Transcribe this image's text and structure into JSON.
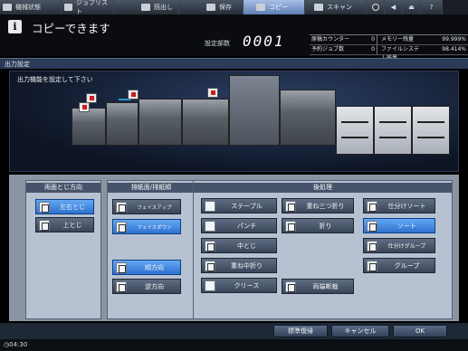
{
  "topbar": {
    "tabs": [
      {
        "label": "機械状態",
        "icon": "machine-status-icon",
        "active": false
      },
      {
        "label": "ジョブリスト",
        "icon": "job-list-icon",
        "active": false
      },
      {
        "label": "読出し",
        "icon": "recall-icon",
        "active": false
      },
      {
        "label": "保存",
        "icon": "save-icon",
        "active": false
      },
      {
        "label": "コピー",
        "icon": "copy-icon",
        "active": true
      },
      {
        "label": "スキャン",
        "icon": "scan-icon",
        "active": false
      }
    ],
    "icons": [
      "globe-icon",
      "volume-icon",
      "eject-icon",
      "help-icon"
    ],
    "help_label": "?"
  },
  "message": {
    "icon_label": "i",
    "text": "コピーできます",
    "set_count_label": "設定部数",
    "set_count_value": "0001"
  },
  "stats": {
    "orig_counter_label": "原稿カウンター",
    "orig_counter_value": "0",
    "reserve_jobs_label": "予約ジョブ数",
    "reserve_jobs_value": "0",
    "memory_label": "メモリー残量",
    "memory_value": "99.999%",
    "filesystem_label": "ファイルシステム残量",
    "filesystem_value": "98.414%"
  },
  "panel": {
    "title": "出力設定",
    "caption": "出力機能を設定して下さい"
  },
  "groups": {
    "duplex": {
      "title": "両面とじ方向",
      "left": "左右とじ",
      "top": "上とじ"
    },
    "output": {
      "title": "排紙面/排紙順",
      "face_up": "フェイスアップ",
      "face_down": "フェイスダウン",
      "forward": "順方向",
      "reverse": "逆方向"
    },
    "finishing": {
      "title": "後処理",
      "staple": "ステープル",
      "fold3": "重ね三つ折り",
      "sort_offset": "仕分けソート",
      "punch": "パンチ",
      "fold": "折り",
      "sort": "ソート",
      "center_staple": "中とじ",
      "group_offset": "仕分けグループ",
      "half_fold": "重ね中折り",
      "group": "グループ",
      "crease": "クリース",
      "two_side_trim": "両端断裁"
    }
  },
  "bottom": {
    "restore": "標準復帰",
    "cancel": "キャンセル",
    "ok": "OK"
  },
  "status": {
    "time": "04:30"
  },
  "colors": {
    "accent": "#2d72cf",
    "panel_bg": "#b6c2d1",
    "header": "#2b3a56"
  }
}
